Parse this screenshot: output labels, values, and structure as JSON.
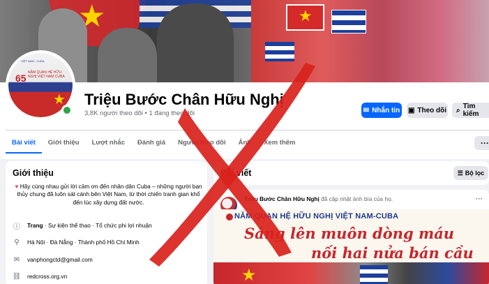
{
  "page": {
    "name": "Triệu Bước Chân Hữu Nghị",
    "followers_line": "3,8K người theo dõi • 1 đang theo dõi",
    "avatar": {
      "number": "65",
      "top_text": "VIỆT NAM - CUBA",
      "title_text": "NĂM QUAN HỆ HỮU NGHỊ VIỆT NAM CUBA"
    }
  },
  "actions": {
    "message": "Nhắn tin",
    "follow": "Theo dõi",
    "search": "Tìm kiếm"
  },
  "tabs": [
    {
      "label": "Bài viết",
      "active": true
    },
    {
      "label": "Giới thiệu"
    },
    {
      "label": "Lượt nhắc"
    },
    {
      "label": "Đánh giá"
    },
    {
      "label": "Người theo dõi"
    },
    {
      "label": "Ảnh"
    },
    {
      "label": "Xem thêm"
    }
  ],
  "more_label": "···",
  "intro": {
    "title": "Giới thiệu",
    "bio": "Hãy cùng nhau gửi lời cảm ơn đến nhân dân Cuba – những người bạn thủy chung đã luôn sát cánh bên Việt Nam, từ thời chiến tranh gian khổ đến lúc xây dựng đất nước.",
    "category_label": "Trang",
    "category_value": " · Sự kiện thể thao · Tổ chức phi lợi nhuận",
    "location": "Hà Nội · Đà Nẵng · Thành phố Hồ Chí Minh",
    "email": "vanphongctd@gmail.com",
    "website": "redcross.org.vn"
  },
  "posts": {
    "title": "Bài viết",
    "filter": "Bộ lọc",
    "post": {
      "author": "Triệu Bước Chân Hữu Nghị",
      "action": " đã cập nhật ảnh bìa của họ.",
      "menu": "···",
      "banner_line": "NĂM QUAN HỆ HỮU NGHỊ VIỆT NAM-CUBA",
      "banner_line1": "Sáng lên muôn dòng máu",
      "banner_line2": "nối hai nửa bán cầu"
    }
  },
  "colors": {
    "accent": "#0866ff",
    "overlay_x": "#d9221c"
  },
  "icons": [
    "messenger-icon",
    "follow-icon",
    "search-icon",
    "filter-icon",
    "info-icon",
    "location-icon",
    "mail-icon",
    "link-icon"
  ]
}
